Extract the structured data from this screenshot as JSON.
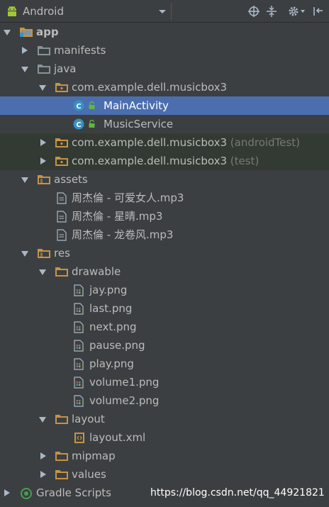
{
  "toolbar": {
    "view_label": "Android",
    "icons": [
      "android-icon",
      "target-icon",
      "collapse-icon",
      "gear-icon",
      "hide-icon"
    ]
  },
  "tree": {
    "app": "app",
    "manifests": "manifests",
    "java": "java",
    "package_main": "com.example.dell.musicbox3",
    "main_activity": "MainActivity",
    "music_service": "MusicService",
    "package_android_test": "com.example.dell.musicbox3",
    "android_test_suffix": "(androidTest)",
    "package_test": "com.example.dell.musicbox3",
    "test_suffix": "(test)",
    "assets": "assets",
    "asset_files": [
      "周杰倫 - 可爱女人.mp3",
      "周杰倫 - 星晴.mp3",
      "周杰倫 - 龙卷风.mp3"
    ],
    "res": "res",
    "drawable": "drawable",
    "drawable_files": [
      "jay.png",
      "last.png",
      "next.png",
      "pause.png",
      "play.png",
      "volume1.png",
      "volume2.png"
    ],
    "layout": "layout",
    "layout_file": "layout.xml",
    "mipmap": "mipmap",
    "values": "values",
    "gradle_scripts": "Gradle Scripts"
  },
  "watermark": "https://blog.csdn.net/qq_44921821",
  "colors": {
    "background": "#3c3f41",
    "selection": "#4b6eaf",
    "folder": "#87939a",
    "package_folder": "#c69347",
    "class_badge": "#3592c4",
    "text": "#bbbbbb"
  }
}
